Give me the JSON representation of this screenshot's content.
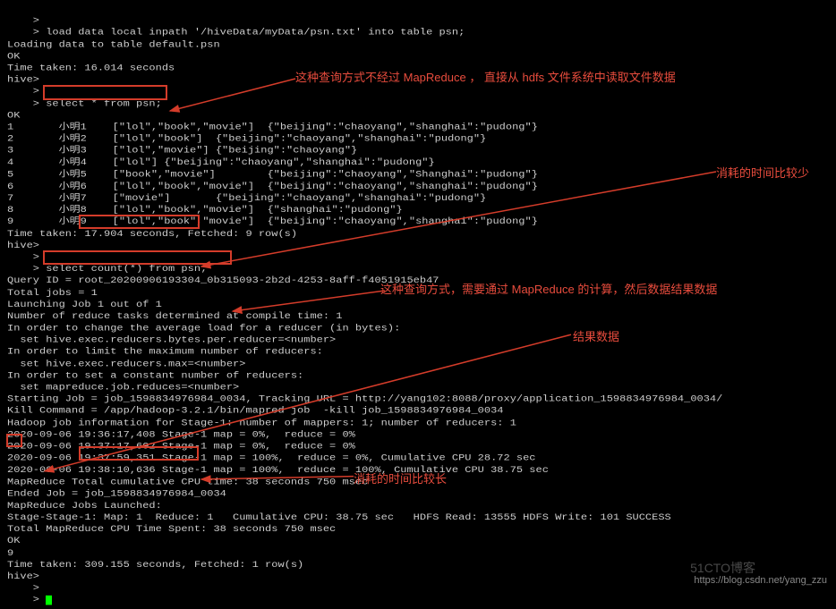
{
  "chart_data": null,
  "terminal": {
    "lines": [
      "    >",
      "    > load data local inpath '/hiveData/myData/psn.txt' into table psn;",
      "Loading data to table default.psn",
      "OK",
      "Time taken: 16.014 seconds",
      "hive>",
      "    >",
      "    > select * from psn;",
      "OK",
      "1       小明1    [\"lol\",\"book\",\"movie\"]  {\"beijing\":\"chaoyang\",\"shanghai\":\"pudong\"}",
      "2       小明2    [\"lol\",\"book\"]  {\"beijing\":\"chaoyang\",\"shanghai\":\"pudong\"}",
      "3       小明3    [\"lol\",\"movie\"] {\"beijing\":\"chaoyang\"}",
      "4       小明4    [\"lol\"] {\"beijing\":\"chaoyang\",\"shanghai\":\"pudong\"}",
      "5       小明5    [\"book\",\"movie\"]        {\"beijing\":\"chaoyang\",\"Shanghai\":\"pudong\"}",
      "6       小明6    [\"lol\",\"book\",\"movie\"]  {\"beijing\":\"chaoyang\",\"shanghai\":\"pudong\"}",
      "7       小明7    [\"movie\"]       {\"beijing\":\"chaoyang\",\"shanghai\":\"pudong\"}",
      "8       小明8    [\"lol\",\"book\",\"movie\"]  {\"shanghai\":\"pudong\"}",
      "9       小明9    [\"lol\",\"book\",\"movie\"]  {\"beijing\":\"chaoyang\",\"shanghai\":\"pudong\"}",
      "Time taken: 17.904 seconds, Fetched: 9 row(s)",
      "hive>",
      "    >",
      "    > select count(*) from psn;",
      "Query ID = root_20200906193304_0b315093-2b2d-4253-8aff-f4051915eb47",
      "Total jobs = 1",
      "Launching Job 1 out of 1",
      "Number of reduce tasks determined at compile time: 1",
      "In order to change the average load for a reducer (in bytes):",
      "  set hive.exec.reducers.bytes.per.reducer=<number>",
      "In order to limit the maximum number of reducers:",
      "  set hive.exec.reducers.max=<number>",
      "In order to set a constant number of reducers:",
      "  set mapreduce.job.reduces=<number>",
      "Starting Job = job_1598834976984_0034, Tracking URL = http://yang102:8088/proxy/application_1598834976984_0034/",
      "Kill Command = /app/hadoop-3.2.1/bin/mapred job  -kill job_1598834976984_0034",
      "Hadoop job information for Stage-1: number of mappers: 1; number of reducers: 1",
      "2020-09-06 19:36:17,408 Stage-1 map = 0%,  reduce = 0%",
      "2020-09-06 19:37:17,692 Stage-1 map = 0%,  reduce = 0%",
      "2020-09-06 19:37:59,351 Stage-1 map = 100%,  reduce = 0%, Cumulative CPU 28.72 sec",
      "2020-09-06 19:38:10,636 Stage-1 map = 100%,  reduce = 100%, Cumulative CPU 38.75 sec",
      "MapReduce Total cumulative CPU time: 38 seconds 750 msec",
      "Ended Job = job_1598834976984_0034",
      "MapReduce Jobs Launched:",
      "Stage-Stage-1: Map: 1  Reduce: 1   Cumulative CPU: 38.75 sec   HDFS Read: 13555 HDFS Write: 101 SUCCESS",
      "Total MapReduce CPU Time Spent: 38 seconds 750 msec",
      "OK",
      "9",
      "Time taken: 309.155 seconds, Fetched: 1 row(s)",
      "hive>",
      "    >",
      "    >"
    ]
  },
  "annotations": {
    "note1": "这种查询方式不经过 MapReduce ， 直接从 hdfs 文件系统中读取文件数据",
    "note2": "消耗的时间比较少",
    "note3": "这种查询方式，需要通过 MapReduce 的计算，然后数据结果数据",
    "note4": "结果数据",
    "note5": "消耗的时间比较长"
  },
  "watermarks": {
    "w1": "https://blog.csdn.net/yang_zzu",
    "w2": "51CTO博客"
  }
}
